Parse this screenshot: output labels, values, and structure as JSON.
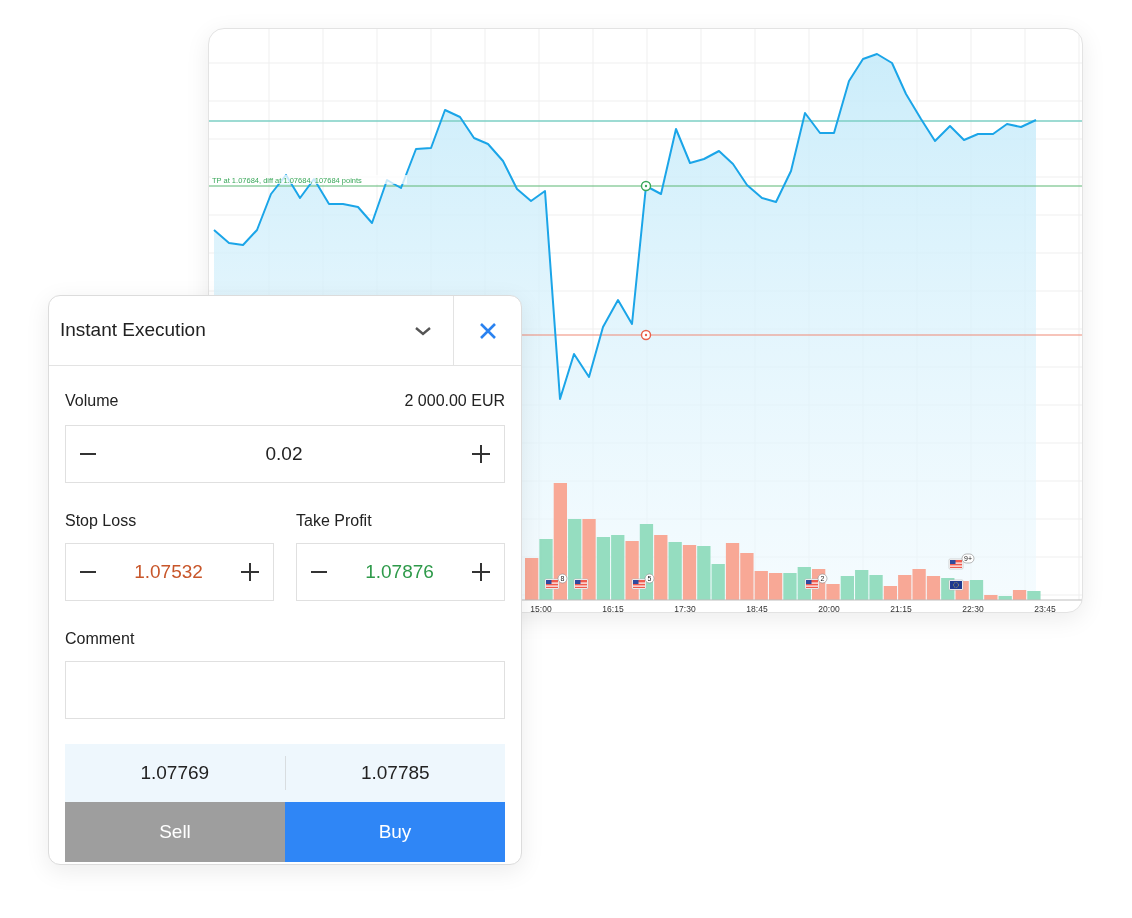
{
  "chart": {
    "tp_label": "TP at 1.07684, diff at 1.07684, 107684 points",
    "time_labels": [
      "15:00",
      "16:15",
      "17:30",
      "18:45",
      "20:00",
      "21:15",
      "22:30",
      "23:45"
    ],
    "events": [
      {
        "kind": "us",
        "count": "8"
      },
      {
        "kind": "us"
      },
      {
        "kind": "us",
        "count": "5"
      },
      {
        "kind": "us",
        "count": "2"
      },
      {
        "kind": "us",
        "count": "9+"
      },
      {
        "kind": "eu"
      }
    ]
  },
  "order_panel": {
    "title": "Instant Execution",
    "volume": {
      "label": "Volume",
      "amount": "2 000.00 EUR",
      "value": "0.02"
    },
    "levels": [
      {
        "kind": "stop_loss",
        "label": "Stop Loss",
        "value": "1.07532"
      },
      {
        "kind": "take_profit",
        "label": "Take Profit",
        "value": "1.07876"
      }
    ],
    "comment": {
      "label": "Comment"
    },
    "quotes": [
      "1.07769",
      "1.07785"
    ],
    "actions": [
      {
        "kind": "sell",
        "label": "Sell",
        "disabled": true
      },
      {
        "kind": "buy",
        "label": "Buy",
        "disabled": false
      }
    ]
  }
}
